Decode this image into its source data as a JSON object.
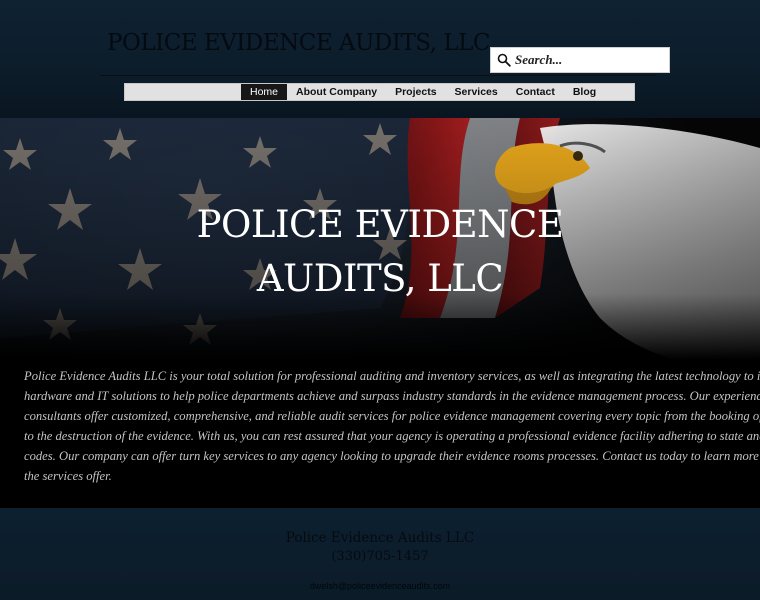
{
  "header": {
    "site_title": "POLICE EVIDENCE AUDITS, LLC",
    "search": {
      "placeholder": "Search...",
      "icon": "search-icon"
    },
    "nav": [
      {
        "label": "Home",
        "active": true
      },
      {
        "label": "About Company",
        "active": false
      },
      {
        "label": "Projects",
        "active": false
      },
      {
        "label": "Services",
        "active": false
      },
      {
        "label": "Contact",
        "active": false
      },
      {
        "label": "Blog",
        "active": false
      }
    ]
  },
  "hero": {
    "title_line1": "POLICE EVIDENCE",
    "title_line2": "AUDITS, LLC",
    "body_lines": [
      "Police Evidence Audits LLC is your total solution for professional auditing and inventory services, as well as integrating the latest technology to include",
      "hardware and IT solutions to help police departments achieve and surpass industry standards in the evidence management process. Our experienced",
      "consultants offer customized, comprehensive, and reliable audit services for police evidence management covering every topic from the booking of evidence",
      "to the destruction of the evidence. With us, you can rest assured that your agency is operating a professional evidence facility adhering to state and local",
      "codes. Our company can offer turn key services to any agency looking to upgrade their evidence rooms processes.  Contact us today to learn more about",
      "the services offer."
    ]
  },
  "footer": {
    "company_name": "Police Evidence Audits LLC",
    "phone": "(330)705-1457",
    "email": "dwelsh@policeevidenceaudits.com"
  },
  "colors": {
    "header_bg": "#0f2233",
    "nav_bg": "#e1e1e1",
    "nav_active_bg": "#171717",
    "hero_text": "#c4c4c4",
    "footer_bg": "#0d2030"
  }
}
